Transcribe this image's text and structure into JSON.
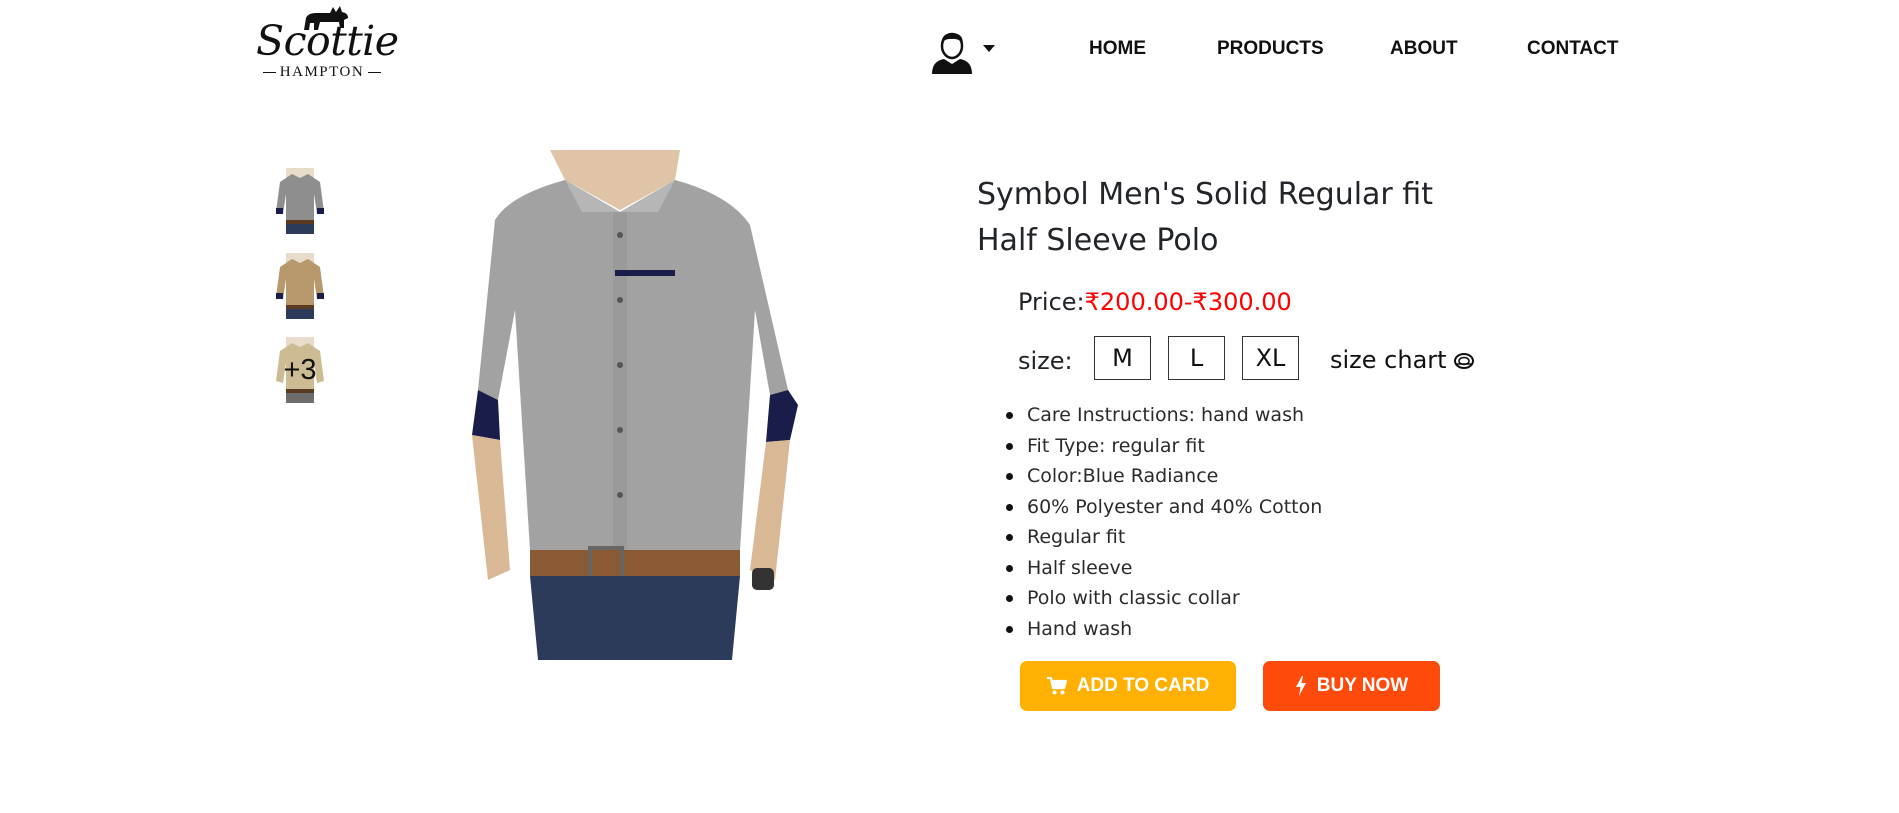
{
  "header": {
    "logo": {
      "script_text": "Scottie",
      "sub_text": "HAMPTON"
    },
    "nav": [
      {
        "label": "HOME"
      },
      {
        "label": "PRODUCTS"
      },
      {
        "label": "ABOUT"
      },
      {
        "label": "CONTACT"
      }
    ]
  },
  "gallery": {
    "thumbnails": [
      {
        "shirt_color": "#8e8e8e"
      },
      {
        "shirt_color": "#b8996e"
      },
      {
        "shirt_color": "#cdbb94"
      }
    ],
    "more_count": "+3",
    "main_shirt_color": "#a2a2a2",
    "accent_color": "#1a1d4a"
  },
  "product": {
    "title": "Symbol Men's Solid Regular fit Half Sleeve Polo",
    "price_label": "Price:",
    "price_value": "₹200.00-₹300.00",
    "price_color": "#ff0000",
    "size_label": "size:",
    "sizes": [
      "M",
      "L",
      "XL"
    ],
    "size_chart_label": "size chart",
    "features": [
      "Care Instructions: hand wash",
      "Fit Type: regular fit",
      "Color:Blue Radiance",
      "60% Polyester and 40% Cotton",
      "Regular fit",
      "Half sleeve",
      "Polo with classic collar",
      "Hand wash"
    ]
  },
  "actions": {
    "add_to_cart_label": "ADD TO CARD",
    "add_to_cart_color": "#ffb000",
    "buy_now_label": "BUY NOW",
    "buy_now_color": "#fe4a0a"
  }
}
